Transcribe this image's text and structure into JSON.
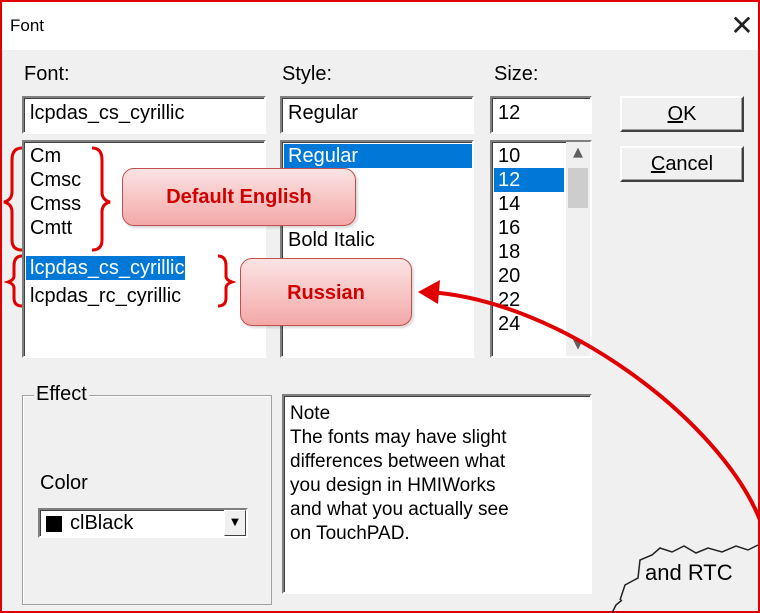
{
  "window": {
    "title": "Font",
    "close_glyph": "✕"
  },
  "font": {
    "label": "Font:",
    "value": "lcpdas_cs_cyrillic",
    "items": [
      "Cm",
      "Cmsc",
      "Cmss",
      "Cmtt",
      "lcpdas_cs_cyrillic",
      "lcpdas_rc_cyrillic"
    ],
    "selected_index": 4
  },
  "style": {
    "label": "Style:",
    "value": "Regular",
    "items": [
      "Regular",
      "Bold Italic"
    ],
    "selected_index": 0
  },
  "size": {
    "label": "Size:",
    "value": "12",
    "items": [
      "10",
      "12",
      "14",
      "16",
      "18",
      "20",
      "22",
      "24"
    ],
    "selected_index": 1
  },
  "buttons": {
    "ok": {
      "mnemonic": "O",
      "rest": "K"
    },
    "cancel": {
      "mnemonic": "C",
      "rest": "ancel"
    }
  },
  "effect": {
    "label": "Effect",
    "color_label": "Color",
    "color_value": "clBlack",
    "swatch_color": "#000000"
  },
  "note": {
    "lines": [
      "Note",
      "The fonts may have slight",
      "differences between what",
      "you design in HMIWorks",
      "and what you actually see",
      "on TouchPAD."
    ]
  },
  "annotations": {
    "default_english": "Default English",
    "russian": "Russian",
    "accent": "#e00000"
  },
  "background_text": "and RTC",
  "icons": {
    "close": "close-icon",
    "scroll_up": "chevron-up-icon",
    "scroll_down": "chevron-down-icon",
    "dropdown": "dropdown-arrow-icon"
  }
}
